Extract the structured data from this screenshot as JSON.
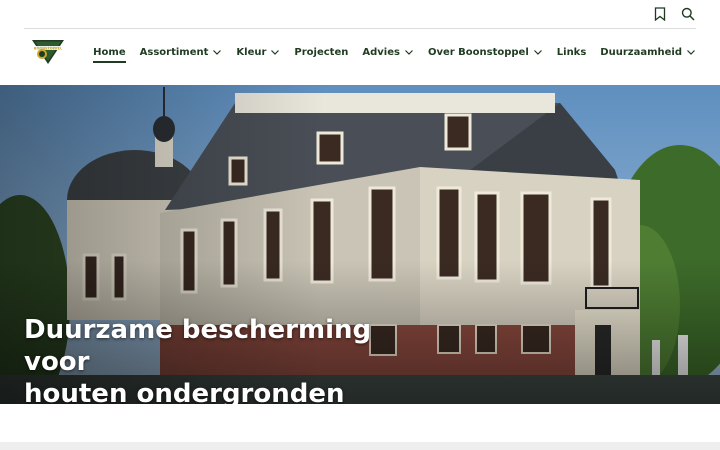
{
  "header": {
    "logo_name": "boonstoppel-logo",
    "icons": [
      "bookmark-icon",
      "search-icon"
    ]
  },
  "nav": {
    "items": [
      {
        "label": "Home",
        "active": true,
        "has_dropdown": false
      },
      {
        "label": "Assortiment",
        "active": false,
        "has_dropdown": true
      },
      {
        "label": "Kleur",
        "active": false,
        "has_dropdown": true
      },
      {
        "label": "Projecten",
        "active": false,
        "has_dropdown": false
      },
      {
        "label": "Advies",
        "active": false,
        "has_dropdown": true
      },
      {
        "label": "Over Boonstoppel",
        "active": false,
        "has_dropdown": true
      },
      {
        "label": "Links",
        "active": false,
        "has_dropdown": false
      },
      {
        "label": "Duurzaamheid",
        "active": false,
        "has_dropdown": true
      }
    ]
  },
  "hero": {
    "title_line1": "Duurzame bescherming voor",
    "title_line2": "houten ondergronden"
  },
  "colors": {
    "brand_green": "#1f3b22",
    "logo_yellow": "#c8a82a"
  }
}
